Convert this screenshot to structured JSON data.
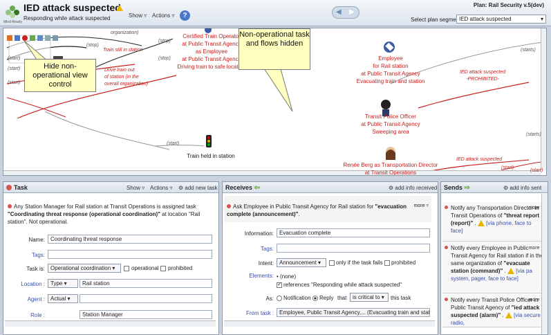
{
  "header": {
    "title": "IED attack suspected",
    "subtitle": "Responding while attack suspected",
    "logo_text": "Mind-Ready",
    "show_menu": "Show",
    "actions_menu": "Actions",
    "help_icon": "?",
    "plan_label": "Plan: Rail Security v.5(dev)",
    "segment_label": "Select plan segment:",
    "segment_value": "IED attack suspected"
  },
  "map": {
    "nodes": {
      "train_operator": "Certified Train Operator\nat Public Transit Agency\nas Employee\nat Public Transit Agency\nDriving train to safe location",
      "employee": "Employee\nfor Rail station\nat Public Transit Agency\nEvacuating train and station",
      "police": "Transit Police Officer\nat Public Transit Agency\nSweeping area",
      "renee": "Renée Berg as Transportation Director\nat Transit Operations",
      "held": "Train held in station"
    },
    "labels": {
      "org": "organization)",
      "stop1": "(stop)",
      "stop2": "(stop)",
      "stop3": "(stop)",
      "still": "Train still in station",
      "drive": "Drive train out\nof station (in the\noverall organization)",
      "start1": "(start)",
      "start2": "(start)",
      "start3": "(start)",
      "start4": "(start)",
      "start5": "(starts)",
      "start6": "(starts)",
      "start7": "(start)",
      "ied_prohibited": "IED attack suspected\n-PROHIBITED-",
      "ied2": "IED attack suspected",
      "start8": "(start)"
    },
    "callouts": {
      "left": "Hide non-operational view control",
      "right": "Non-operational task and flows hidden"
    }
  },
  "task_panel": {
    "title": "Task",
    "show": "Show",
    "actions": "Actions",
    "add_task": "add new task",
    "desc_pre": "Any Station Manager for Rail station at Transit Operations is assigned task ",
    "desc_bold": "\"Coordinating threat response (operational coordination)\"",
    "desc_post": " at location \"Rail station\". Not operational.",
    "name_label": "Name:",
    "name_value": "Coordinating threat response",
    "tags_label": "Tags:",
    "taskis_label": "Task is:",
    "taskis_value": "Operational coordination",
    "operational": "operational",
    "prohibited": "prohibited",
    "location_label": "Location :",
    "location_type": "Type",
    "location_value": "Rail station",
    "agent_label": "Agent :",
    "agent_type": "Actual",
    "agent_value": "",
    "role_label": "Role :",
    "role_value": "Station Manager"
  },
  "receives_panel": {
    "title": "Receives",
    "add_info": "add info received",
    "desc_pre": "Ask Employee in Public Transit Agency for Rail station for ",
    "desc_bold": "\"evacuation complete (announcement)\"",
    "desc_post": ".",
    "more": "more",
    "info_label": "Information:",
    "info_value": "Evacuation complete",
    "tags_label": "Tags:",
    "intent_label": "Intent:",
    "intent_value": "Announcement",
    "only_if": "only if the task fails",
    "prohibited": "prohibited",
    "elements_label": "Elements:",
    "elements_none": "(none)",
    "references": "references \"Responding while attack suspected\"",
    "as_label": "As:",
    "as_notification": "Notification",
    "as_reply": "Reply",
    "that": "that",
    "critical": "is critical to",
    "this_task": "this task",
    "from_label": "From task :",
    "from_value": "Employee, Public Transit Agency,... (Evacuating train and stat"
  },
  "sends_panel": {
    "title": "Sends",
    "add_info": "add info sent",
    "items": [
      {
        "pre": "Notify any Transportation Director in Transit Operations of ",
        "bold": "\"threat report (report)\"",
        "post": " . ",
        "via": "[via phone, face to face]"
      },
      {
        "pre": "Notify every Employee in Public Transit Agency for Rail station if in the same organization of ",
        "bold": "\"evacuate station (command)\"",
        "post": " . ",
        "via": "[via pa system, pager, face to face]"
      },
      {
        "pre": "Notify every Transit Police Officer in Public Transit Agency of ",
        "bold": "\"ied attack suspected (alarm)\"",
        "post": " . ",
        "via": "[via secure radio,"
      }
    ],
    "more": "more"
  }
}
